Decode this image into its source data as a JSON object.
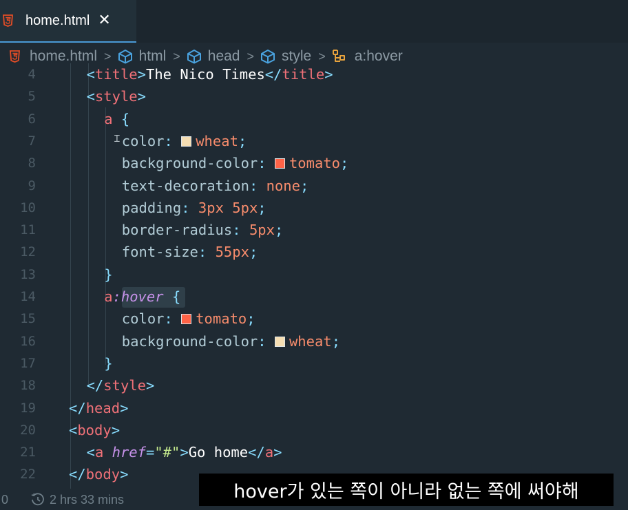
{
  "tab": {
    "label": "home.html",
    "close": "✕"
  },
  "breadcrumb": [
    "home.html",
    "html",
    "head",
    "style",
    "a:hover"
  ],
  "lines": [
    {
      "n": "4",
      "indent": 2,
      "tokens": [
        [
          "tag",
          "<"
        ],
        [
          "tname",
          "title"
        ],
        [
          "tag",
          ">"
        ],
        [
          "plain",
          "The Nico Times"
        ],
        [
          "tag",
          "</"
        ],
        [
          "tname",
          "title"
        ],
        [
          "tag",
          ">"
        ]
      ]
    },
    {
      "n": "5",
      "indent": 2,
      "tokens": [
        [
          "tag",
          "<"
        ],
        [
          "tname",
          "style"
        ],
        [
          "tag",
          ">"
        ]
      ]
    },
    {
      "n": "6",
      "indent": 3,
      "tokens": [
        [
          "sel-a",
          "a"
        ],
        [
          "plain",
          " "
        ],
        [
          "brace",
          "{"
        ]
      ]
    },
    {
      "n": "7",
      "indent": 4,
      "tokens": [
        [
          "prop",
          "color"
        ],
        [
          "punc",
          ": "
        ],
        [
          "swatch",
          "#f5deb3"
        ],
        [
          "val",
          "wheat"
        ],
        [
          "punc",
          ";"
        ]
      ]
    },
    {
      "n": "8",
      "indent": 4,
      "tokens": [
        [
          "prop",
          "background-color"
        ],
        [
          "punc",
          ": "
        ],
        [
          "swatch",
          "#ff6347"
        ],
        [
          "val",
          "tomato"
        ],
        [
          "punc",
          ";"
        ]
      ]
    },
    {
      "n": "9",
      "indent": 4,
      "tokens": [
        [
          "prop",
          "text-decoration"
        ],
        [
          "punc",
          ": "
        ],
        [
          "val",
          "none"
        ],
        [
          "punc",
          ";"
        ]
      ]
    },
    {
      "n": "10",
      "indent": 4,
      "tokens": [
        [
          "prop",
          "padding"
        ],
        [
          "punc",
          ": "
        ],
        [
          "val",
          "3px 5px"
        ],
        [
          "punc",
          ";"
        ]
      ]
    },
    {
      "n": "11",
      "indent": 4,
      "tokens": [
        [
          "prop",
          "border-radius"
        ],
        [
          "punc",
          ": "
        ],
        [
          "val",
          "5px"
        ],
        [
          "punc",
          ";"
        ]
      ]
    },
    {
      "n": "12",
      "indent": 4,
      "tokens": [
        [
          "prop",
          "font-size"
        ],
        [
          "punc",
          ": "
        ],
        [
          "val",
          "55px"
        ],
        [
          "punc",
          ";"
        ]
      ]
    },
    {
      "n": "13",
      "indent": 3,
      "tokens": [
        [
          "brace",
          "}"
        ]
      ]
    },
    {
      "n": "14",
      "indent": 3,
      "tokens": [
        [
          "sel-a",
          "a"
        ],
        [
          "pseudo",
          ":hover"
        ],
        [
          "plain",
          " "
        ],
        [
          "brace",
          "{"
        ]
      ]
    },
    {
      "n": "15",
      "indent": 4,
      "tokens": [
        [
          "prop",
          "color"
        ],
        [
          "punc",
          ": "
        ],
        [
          "swatch",
          "#ff6347"
        ],
        [
          "val",
          "tomato"
        ],
        [
          "punc",
          ";"
        ]
      ]
    },
    {
      "n": "16",
      "indent": 4,
      "tokens": [
        [
          "prop",
          "background-color"
        ],
        [
          "punc",
          ": "
        ],
        [
          "swatch",
          "#f5deb3"
        ],
        [
          "val",
          "wheat"
        ],
        [
          "punc",
          ";"
        ]
      ]
    },
    {
      "n": "17",
      "indent": 3,
      "tokens": [
        [
          "brace",
          "}"
        ]
      ]
    },
    {
      "n": "18",
      "indent": 2,
      "tokens": [
        [
          "tag",
          "</"
        ],
        [
          "tname",
          "style"
        ],
        [
          "tag",
          ">"
        ]
      ]
    },
    {
      "n": "19",
      "indent": 1,
      "tokens": [
        [
          "tag",
          "</"
        ],
        [
          "tname",
          "head"
        ],
        [
          "tag",
          ">"
        ]
      ]
    },
    {
      "n": "20",
      "indent": 1,
      "tokens": [
        [
          "tag",
          "<"
        ],
        [
          "tname",
          "body"
        ],
        [
          "tag",
          ">"
        ]
      ]
    },
    {
      "n": "21",
      "indent": 2,
      "tokens": [
        [
          "tag",
          "<"
        ],
        [
          "tname",
          "a"
        ],
        [
          "plain",
          " "
        ],
        [
          "attr",
          "href"
        ],
        [
          "tag",
          "="
        ],
        [
          "str",
          "\"#\""
        ],
        [
          "tag",
          ">"
        ],
        [
          "plain",
          "Go home"
        ],
        [
          "tag",
          "</"
        ],
        [
          "tname",
          "a"
        ],
        [
          "tag",
          ">"
        ]
      ]
    },
    {
      "n": "22",
      "indent": 1,
      "tokens": [
        [
          "tag",
          "</"
        ],
        [
          "tname",
          "body"
        ],
        [
          "tag",
          ">"
        ]
      ]
    }
  ],
  "status": {
    "left": "0",
    "time": "2 hrs 33 mins"
  },
  "caption": "hover가 있는 쪽이 아니라 없는 쪽에 써야해",
  "colors": {
    "accent": "#4a9ad6",
    "background": "#1f2a33",
    "wheat": "#f5deb3",
    "tomato": "#ff6347"
  }
}
